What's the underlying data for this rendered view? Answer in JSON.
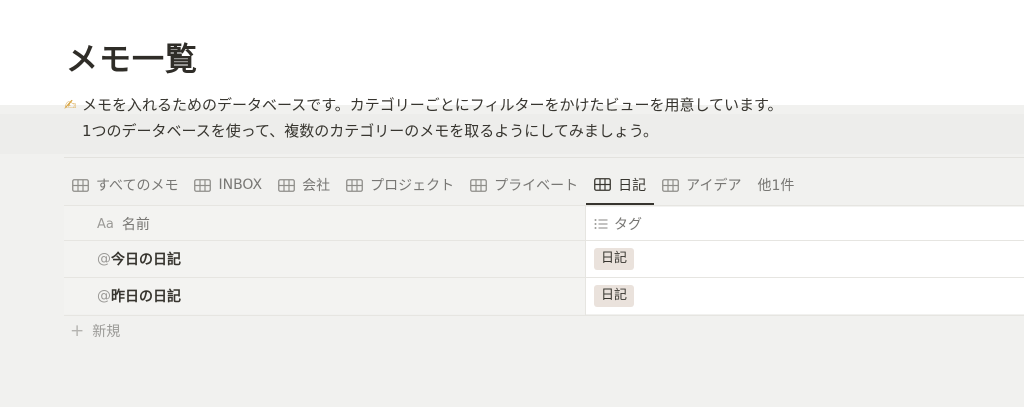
{
  "page": {
    "title": "メモ一覧",
    "description_emoji": "✍",
    "description_line1": "メモを入れるためのデータベースです。カテゴリーごとにフィルターをかけたビューを用意しています。",
    "description_line2": "1つのデータベースを使って、複数のカテゴリーのメモを取るようにしてみましょう。"
  },
  "tabs": [
    {
      "label": "すべてのメモ",
      "icon": "table-icon",
      "active": false
    },
    {
      "label": "INBOX",
      "icon": "table-icon",
      "active": false
    },
    {
      "label": "会社",
      "icon": "table-icon",
      "active": false
    },
    {
      "label": "プロジェクト",
      "icon": "table-icon",
      "active": false
    },
    {
      "label": "プライベート",
      "icon": "table-icon",
      "active": false
    },
    {
      "label": "日記",
      "icon": "table-icon",
      "active": true
    },
    {
      "label": "アイデア",
      "icon": "table-icon",
      "active": false
    }
  ],
  "tabs_more": "他1件",
  "table": {
    "columns": [
      {
        "icon_text": "Aa",
        "label": "名前"
      },
      {
        "icon": "list-icon",
        "label": "タグ"
      }
    ],
    "rows": [
      {
        "at": "@",
        "mention": "今日",
        "suffix": "の日記",
        "tag": "日記"
      },
      {
        "at": "@",
        "mention": "昨日",
        "suffix": "の日記",
        "tag": "日記"
      }
    ],
    "new_label": "新規"
  },
  "colors": {
    "text": "#37352f",
    "muted": "#787774",
    "tag_bg": "#eae2dc",
    "page_bg_lower": "#f1f1ef"
  }
}
